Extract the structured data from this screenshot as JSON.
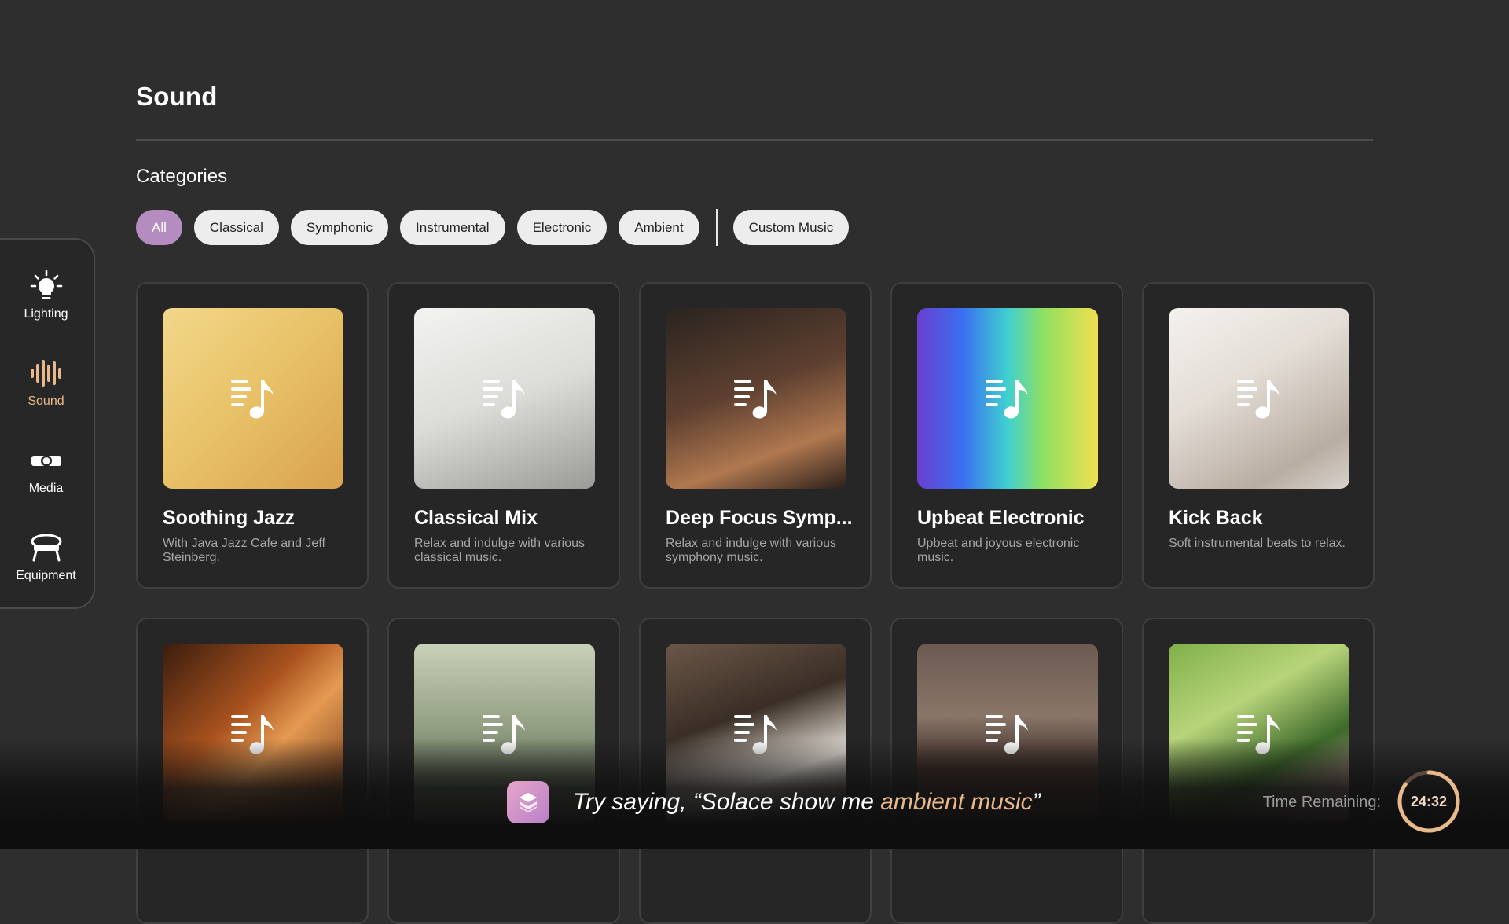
{
  "page": {
    "title": "Sound"
  },
  "categories": {
    "heading": "Categories",
    "chips": [
      "All",
      "Classical",
      "Symphonic",
      "Instrumental",
      "Electronic",
      "Ambient"
    ],
    "custom": "Custom Music",
    "selected": "All"
  },
  "sidebar": {
    "items": [
      {
        "label": "Lighting",
        "icon": "lightbulb-icon"
      },
      {
        "label": "Sound",
        "icon": "sound-wave-icon",
        "active": true
      },
      {
        "label": "Media",
        "icon": "projector-icon"
      },
      {
        "label": "Equipment",
        "icon": "massage-bed-icon"
      }
    ]
  },
  "playlists": [
    {
      "title": "Soothing Jazz",
      "description": "With Java Jazz Cafe and Jeff Steinberg.",
      "art": "jazz-band-illustration"
    },
    {
      "title": "Classical Mix",
      "description": "Relax and indulge with various classical music.",
      "art": "sheet-music-photo"
    },
    {
      "title": "Deep Focus Symp...",
      "description": "Relax and indulge with various symphony music.",
      "art": "orchestra-cellists-photo"
    },
    {
      "title": "Upbeat Electronic",
      "description": "Upbeat and joyous electronic music.",
      "art": "equalizer-bars"
    },
    {
      "title": "Kick Back",
      "description": "Soft instrumental beats to relax.",
      "art": "relaxing-hands-photo"
    },
    {
      "title": "",
      "description": "",
      "art": "violin-strings-photo"
    },
    {
      "title": "",
      "description": "",
      "art": "misty-mountain-lake-photo"
    },
    {
      "title": "",
      "description": "",
      "art": "piano-keys-photo"
    },
    {
      "title": "",
      "description": "",
      "art": "orchestra-stage-photo"
    },
    {
      "title": "",
      "description": "",
      "art": "lotus-water-photo"
    }
  ],
  "voice": {
    "prefix": "Try saying, “Solace show me ",
    "highlight": "ambient music",
    "suffix": "”"
  },
  "timer": {
    "label": "Time Remaining:",
    "value": "24:32",
    "progress_fraction": 0.85
  },
  "colors": {
    "accent": "#e8b98a",
    "chip_active": "#b48cc0",
    "background": "#2e2e2e"
  }
}
